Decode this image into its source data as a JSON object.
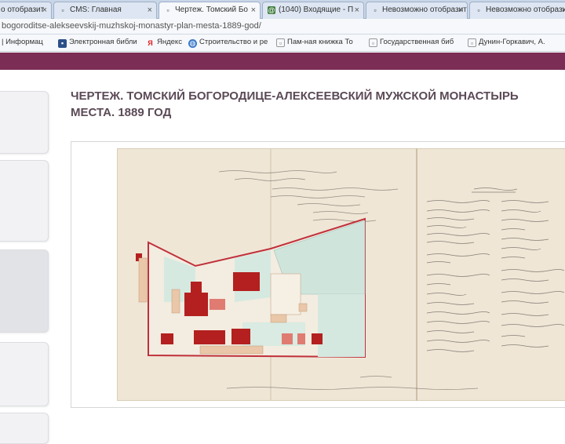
{
  "browser": {
    "tabs": [
      {
        "title": "о отобразит",
        "icon": "document-icon"
      },
      {
        "title": "CMS: Главная",
        "icon": "document-icon"
      },
      {
        "title": "Чертеж. Томский Бо",
        "icon": "document-icon",
        "active": true
      },
      {
        "title": "(1040) Входящие - П",
        "icon": "mail-icon"
      },
      {
        "title": "Невозможно отобразить",
        "icon": "document-icon"
      },
      {
        "title": "Невозможно отобразит",
        "icon": "document-icon"
      }
    ],
    "url": "bogoroditse-alekseevskij-muzhskoj-monastyr-plan-mesta-1889-god/",
    "bookmarks": [
      {
        "label": "| Информац",
        "icon": "info-icon"
      },
      {
        "label": "Электронная библи",
        "icon": "library-icon"
      },
      {
        "label": "Яндекс",
        "icon": "yandex-icon"
      },
      {
        "label": "Строительство и ре",
        "icon": "globe-icon"
      },
      {
        "label": "Пам-ная книжка То",
        "icon": "document-icon"
      },
      {
        "label": "Государственная биб",
        "icon": "document-icon"
      },
      {
        "label": "Дунин-Горкавич, А.",
        "icon": "document-icon"
      }
    ]
  },
  "page": {
    "title_line1": "ЧЕРТЕЖ. ТОМСКИЙ БОГОРОДИЦЕ-АЛЕКСЕЕВСКИЙ МУЖСКОЙ МОНАСТЫРЬ",
    "title_line2": "МЕСТА. 1889 ГОД"
  },
  "colors": {
    "header": "#7b2d55",
    "title": "#5b4a56",
    "paper": "#efe6d6",
    "building_red": "#b3201f",
    "garden_green": "#cfe5dc",
    "boundary": "#c0303a"
  }
}
